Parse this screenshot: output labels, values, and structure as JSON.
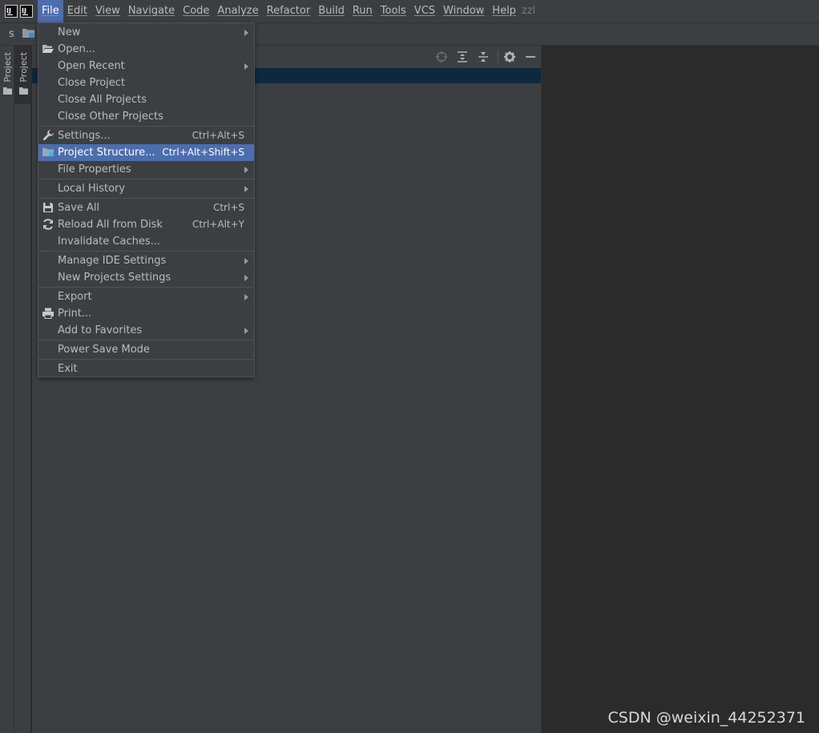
{
  "menubar": {
    "items": [
      {
        "label": "File"
      },
      {
        "label": "Edit"
      },
      {
        "label": "View"
      },
      {
        "label": "Navigate"
      },
      {
        "label": "Code"
      },
      {
        "label": "Analyze"
      },
      {
        "label": "Refactor"
      },
      {
        "label": "Build"
      },
      {
        "label": "Run"
      },
      {
        "label": "Tools"
      },
      {
        "label": "VCS"
      },
      {
        "label": "Window"
      },
      {
        "label": "Help"
      }
    ],
    "title": "zzl",
    "app_icon_text": "IJ"
  },
  "navbar": {
    "label": "s"
  },
  "sidebar": {
    "tab_label": "Project"
  },
  "file_menu": {
    "items": [
      {
        "label": "New"
      },
      {
        "label": "Open..."
      },
      {
        "label": "Open Recent"
      },
      {
        "label": "Close Project"
      },
      {
        "label": "Close All Projects"
      },
      {
        "label": "Close Other Projects"
      },
      {
        "label": "Settings...",
        "shortcut": "Ctrl+Alt+S"
      },
      {
        "label": "Project Structure...",
        "shortcut": "Ctrl+Alt+Shift+S"
      },
      {
        "label": "File Properties"
      },
      {
        "label": "Local History"
      },
      {
        "label": "Save All",
        "shortcut": "Ctrl+S"
      },
      {
        "label": "Reload All from Disk",
        "shortcut": "Ctrl+Alt+Y"
      },
      {
        "label": "Invalidate Caches..."
      },
      {
        "label": "Manage IDE Settings"
      },
      {
        "label": "New Projects Settings"
      },
      {
        "label": "Export"
      },
      {
        "label": "Print..."
      },
      {
        "label": "Add to Favorites"
      },
      {
        "label": "Power Save Mode"
      },
      {
        "label": "Exit"
      }
    ]
  },
  "watermark": "CSDN @weixin_44252371",
  "colors": {
    "highlight": "#4b6eaf",
    "background": "#2b2b2b",
    "panel": "#3c3f41",
    "selection": "#0d293e"
  }
}
